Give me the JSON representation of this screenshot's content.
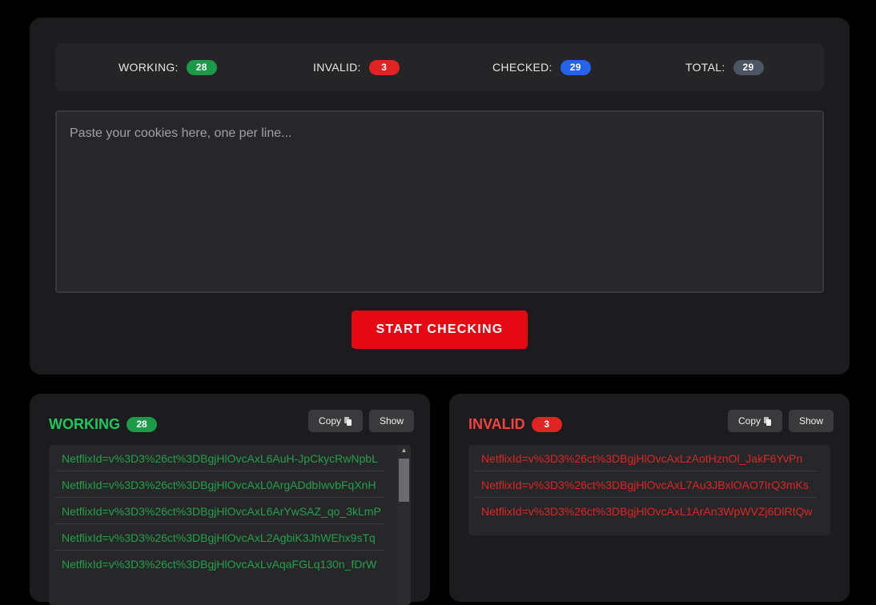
{
  "stats": {
    "working_label": "WORKING:",
    "working_count": "28",
    "invalid_label": "INVALID:",
    "invalid_count": "3",
    "checked_label": "CHECKED:",
    "checked_count": "29",
    "total_label": "TOTAL:",
    "total_count": "29"
  },
  "input": {
    "placeholder": "Paste your cookies here, one per line...",
    "value": ""
  },
  "start_button": {
    "label": "START CHECKING"
  },
  "working_panel": {
    "title": "WORKING",
    "count": "28",
    "copy_label": "Copy",
    "show_label": "Show",
    "items": [
      "NetflixId=v%3D3%26ct%3DBgjHlOvcAxL6AuH-JpCkycRwNpbL",
      "NetflixId=v%3D3%26ct%3DBgjHlOvcAxL0ArgADdbIwvbFqXnH",
      "NetflixId=v%3D3%26ct%3DBgjHlOvcAxL6ArYwSAZ_qo_3kLmP",
      "NetflixId=v%3D3%26ct%3DBgjHlOvcAxL2AgbiK3JhWEhx9sTq",
      "NetflixId=v%3D3%26ct%3DBgjHlOvcAxLvAqaFGLq130n_fDrW"
    ]
  },
  "invalid_panel": {
    "title": "INVALID",
    "count": "3",
    "copy_label": "Copy",
    "show_label": "Show",
    "items": [
      "NetflixId=v%3D3%26ct%3DBgjHlOvcAxLzAotHznOl_JakF6YvPn",
      "NetflixId=v%3D3%26ct%3DBgjHlOvcAxL7Au3JBxlOAO7IrQ3mKs",
      "NetflixId=v%3D3%26ct%3DBgjHlOvcAxL1ArAn3WpWVZj6DlRtQw"
    ]
  },
  "colors": {
    "accent_red": "#e50914",
    "working_green": "#22c55e",
    "invalid_red": "#ef4444",
    "checked_blue": "#2563eb",
    "total_gray": "#4b5563"
  },
  "icons": {
    "copy": "copy-icon",
    "scroll_up": "chevron-up-icon"
  }
}
